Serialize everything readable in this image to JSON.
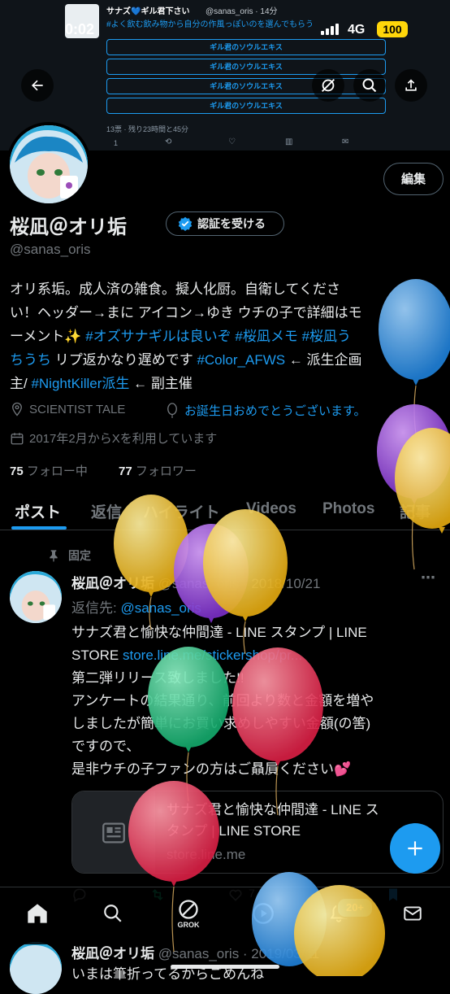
{
  "status_bar": {
    "time": "0:02",
    "network": "4G",
    "battery": "100"
  },
  "banner": {
    "author": "サナズ💙ギル君下さい",
    "handle_time": "@sanas_oris · 14分",
    "text": "#よく飲む飲み物から自分の作風っぽいのを選んでもらう",
    "poll_options": [
      "ギル君のソウルエキス",
      "ギル君のソウルエキス",
      "ギル君のソウルエキス",
      "ギル君のソウルエキス"
    ],
    "poll_meta": "13票 · 残り23時間と45分",
    "reply_count": "1"
  },
  "profile": {
    "edit_label": "編集",
    "name": "桜凪＠オリ垢",
    "verify_label": "認証を受ける",
    "handle": "@sanas_oris",
    "bio_1": "オリ系垢。成人済の雑食。擬人化厨。自衛してくださ",
    "bio_2a": "い！ヘッダー→まに アイコン→ゆき ウチの子で詳細はモ",
    "bio_3a": "ーメント✨ ",
    "bio_3b": "#オズサナギルは良いぞ #桜凪メモ #桜凪う",
    "bio_4a": "ちうち",
    "bio_4b": " リプ返かなり遅めです ",
    "bio_4c": "#Color_AFWS",
    "bio_4d": " ← 派生企画",
    "bio_5a": "主/ ",
    "bio_5b": "#NightKiller派生",
    "bio_5c": " ← 副主催",
    "location": "SCIENTIST TALE",
    "birthday": "お誕生日おめでとうございます。",
    "joined": "2017年2月からXを利用しています",
    "following_count": "75",
    "following_label": "フォロー中",
    "followers_count": "77",
    "followers_label": "フォロワー"
  },
  "tabs": [
    "ポスト",
    "返信",
    "ハイライト",
    "Videos",
    "Photos",
    "記事"
  ],
  "pinned_tweet": {
    "pinned_label": "固定",
    "author": "桜凪＠オリ垢",
    "handle": "@sanas_oris",
    "date": "· 2018/10/21",
    "reply_to_label": "返信先: ",
    "reply_to_handle": "@sanas_oris",
    "line1": "サナズ君と愉快な仲間達 - LINE スタンプ | LINE",
    "line2a": "STORE ",
    "line2b": "store.line.me/stickershop/pr...",
    "line3": "第二弾リリース致しました!!",
    "line4": "アンケートの結果通り、前回より数と金額を増や",
    "line5": "しましたが簡単にお買い求めしやすい金額(の筈)",
    "line6": "ですので、",
    "line7": "是非ウチの子ファンの方はご贔屓ください💕",
    "card_title_1": "サナズ君と愉快な仲間達 - LINE ス",
    "card_title_2": "タンプ | LINE STORE",
    "card_domain": "store.line.me",
    "like_count": "7"
  },
  "next_tweet": {
    "author": "桜凪＠オリ垢",
    "handle": "@sanas_oris · 2019/03/11",
    "text": "いまは筆折ってるからごめんね"
  },
  "nav": {
    "grok_label": "GROK",
    "notif_badge": "20+"
  },
  "icons": [
    "back-arrow-icon",
    "no-notify-icon",
    "search-icon",
    "share-icon",
    "verified-badge-icon",
    "location-icon",
    "balloon-icon",
    "calendar-icon",
    "pin-icon",
    "article-icon",
    "reply-icon",
    "retweet-icon",
    "like-icon",
    "bookmark-icon",
    "plus-icon",
    "home-icon",
    "grok-icon",
    "play-icon",
    "bell-icon",
    "mail-icon"
  ],
  "colors": {
    "accent": "#1d9bf0",
    "bg": "#000000",
    "muted": "#71767b",
    "text": "#e7e9ea",
    "retweet": "#00ba7c"
  }
}
